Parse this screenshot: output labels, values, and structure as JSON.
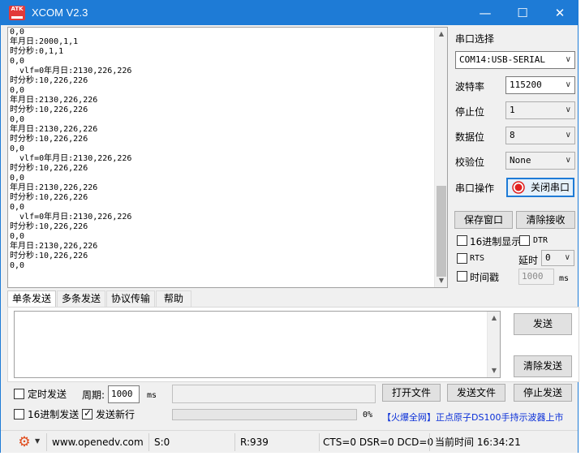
{
  "window": {
    "title": "XCOM V2.3",
    "icon_text": "ATK",
    "controls": {
      "minimize": "—",
      "maximize": "☐",
      "close": "✕"
    }
  },
  "receive": {
    "lines": [
      "0,0",
      "年月日:2000,1,1",
      "时分秒:0,1,1",
      "0,0",
      "  vlf=0年月日:2130,226,226",
      "时分秒:10,226,226",
      "0,0",
      "年月日:2130,226,226",
      "时分秒:10,226,226",
      "0,0",
      "年月日:2130,226,226",
      "时分秒:10,226,226",
      "0,0",
      "  vlf=0年月日:2130,226,226",
      "时分秒:10,226,226",
      "0,0",
      "年月日:2130,226,226",
      "时分秒:10,226,226",
      "0,0",
      "  vlf=0年月日:2130,226,226",
      "时分秒:10,226,226",
      "0,0",
      "年月日:2130,226,226",
      "时分秒:10,226,226",
      "0,0"
    ]
  },
  "settings": {
    "port_select_label": "串口选择",
    "port_value": "COM14:USB-SERIAL",
    "baud_label": "波特率",
    "baud_value": "115200",
    "stopbits_label": "停止位",
    "stopbits_value": "1",
    "databits_label": "数据位",
    "databits_value": "8",
    "parity_label": "校验位",
    "parity_value": "None",
    "port_op_label": "串口操作",
    "close_port_button": "关闭串口",
    "save_window_button": "保存窗口",
    "clear_receive_button": "清除接收",
    "hex_display_label": "16进制显示",
    "dtr_label": "DTR",
    "rts_label": "RTS",
    "delay_label": "延时",
    "delay_value": "0",
    "timestamp_label": "时间戳",
    "timestamp_value": "1000",
    "timestamp_unit": "ms"
  },
  "tabs": [
    {
      "label": "单条发送",
      "active": true
    },
    {
      "label": "多条发送",
      "active": false
    },
    {
      "label": "协议传输",
      "active": false
    },
    {
      "label": "帮助",
      "active": false
    }
  ],
  "send": {
    "send_button": "发送",
    "clear_send_button": "清除发送",
    "timed_send_label": "定时发送",
    "period_label": "周期:",
    "period_value": "1000",
    "period_unit": "ms",
    "open_file_button": "打开文件",
    "send_file_button": "发送文件",
    "stop_send_button": "停止发送",
    "hex_send_label": "16进制发送",
    "send_newline_label": "发送新行",
    "send_newline_checked": true,
    "progress_text": "0%",
    "progress_fraction": 0,
    "ad_text": "【火爆全网】正点原子DS100手持示波器上市"
  },
  "statusbar": {
    "website": "www.openedv.com",
    "sent": "S:0",
    "received": "R:939",
    "signals": "CTS=0 DSR=0 DCD=0",
    "time": "当前时间 16:34:21"
  },
  "colors": {
    "titlebar": "#1e7bd6",
    "accent_link": "#0a2fd8",
    "close_port_indicator": "#e02020"
  }
}
